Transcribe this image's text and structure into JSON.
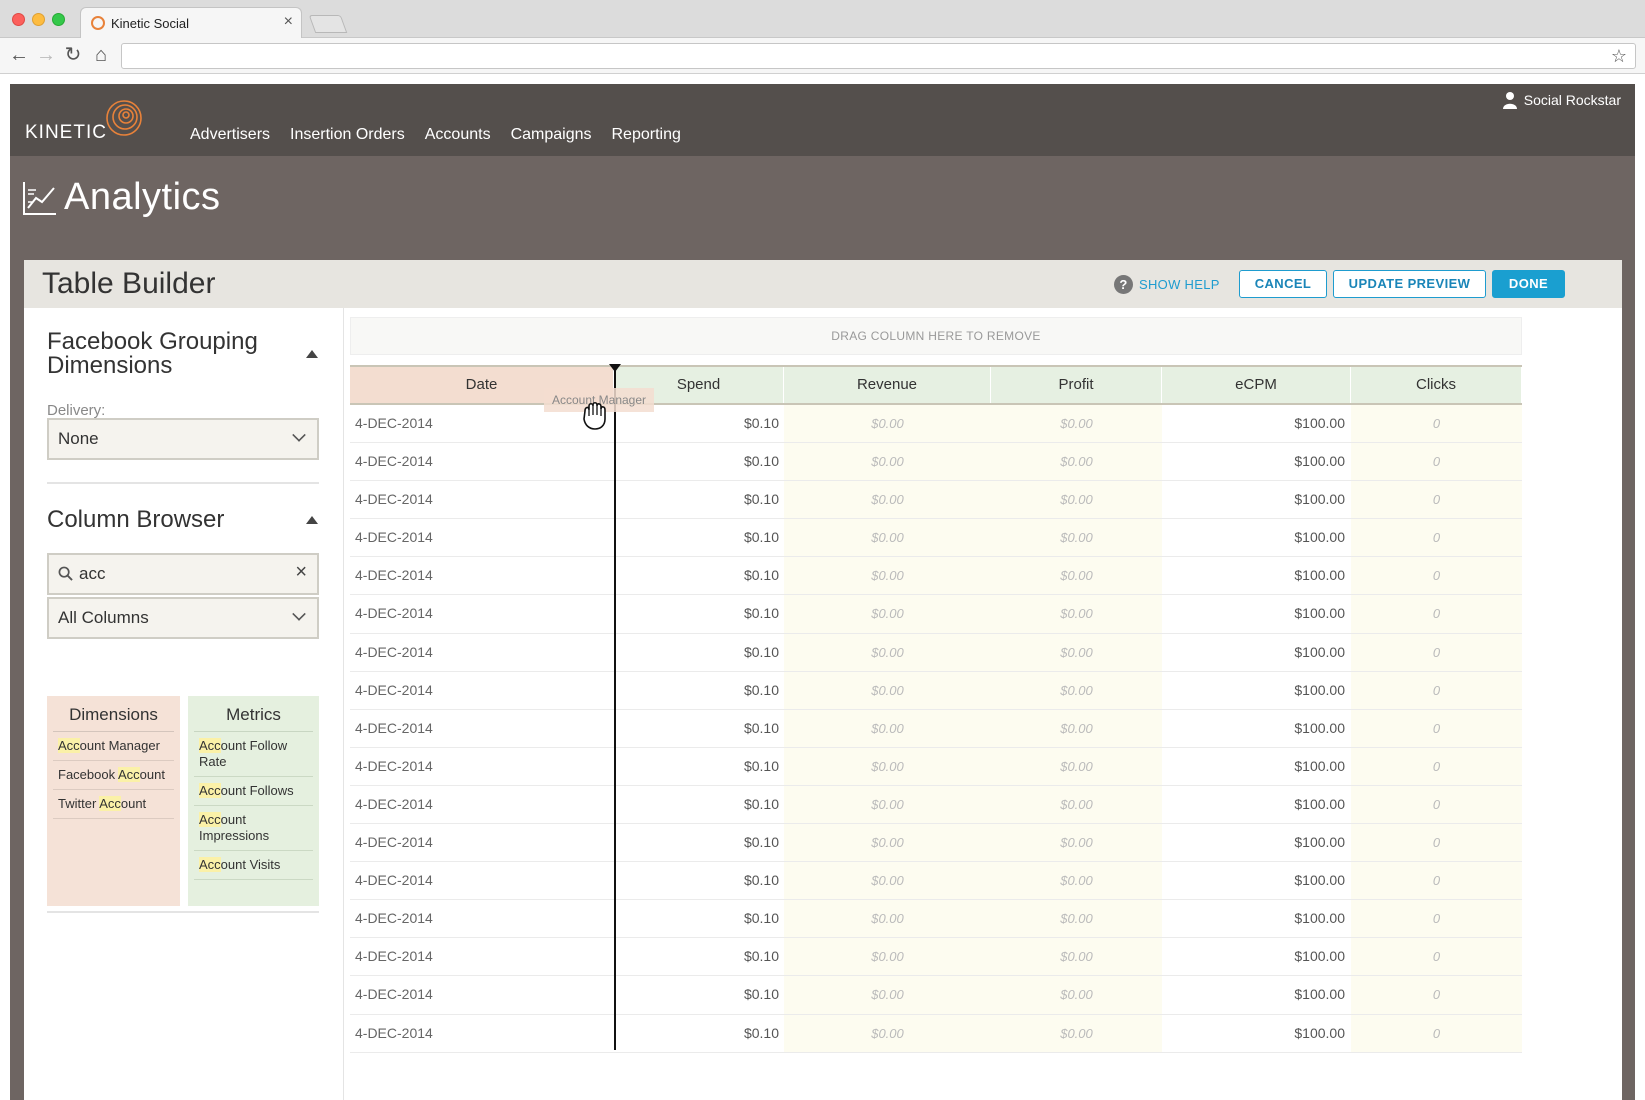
{
  "browser": {
    "tab_title": "Kinetic Social",
    "url": ""
  },
  "app": {
    "logo": "KINETIC",
    "nav": [
      "Advertisers",
      "Insertion Orders",
      "Accounts",
      "Campaigns",
      "Reporting"
    ],
    "user": "Social Rockstar",
    "page_title": "Analytics"
  },
  "panel": {
    "title": "Table Builder",
    "help_label": "SHOW HELP",
    "cancel_label": "CANCEL",
    "update_label": "UPDATE PREVIEW",
    "done_label": "DONE"
  },
  "grouping": {
    "title_line1": "Facebook Grouping",
    "title_line2": "Dimensions",
    "delivery_label": "Delivery:",
    "delivery_value": "None"
  },
  "browser_panel": {
    "title": "Column Browser",
    "search_value": "acc",
    "filter_value": "All Columns",
    "dimensions_title": "Dimensions",
    "metrics_title": "Metrics",
    "dimensions": [
      {
        "hl": "Acc",
        "rest": "ount Manager",
        "pre": ""
      },
      {
        "pre": "Facebook ",
        "hl": "Acc",
        "rest": "ount"
      },
      {
        "pre": "Twitter ",
        "hl": "Acc",
        "rest": "ount"
      }
    ],
    "metrics": [
      {
        "pre": "",
        "hl": "Acc",
        "rest": "ount Follow Rate"
      },
      {
        "pre": "",
        "hl": "Acc",
        "rest": "ount Follows"
      },
      {
        "pre": "",
        "hl": "Acc",
        "rest": "ount Impressions"
      },
      {
        "pre": "",
        "hl": "Acc",
        "rest": "ount Visits"
      }
    ]
  },
  "table": {
    "drop_zone": "DRAG COLUMN HERE TO REMOVE",
    "drag_ghost": "Account Manager",
    "columns": [
      "Date",
      "Spend",
      "Revenue",
      "Profit",
      "eCPM",
      "Clicks"
    ],
    "rows": [
      [
        "4-DEC-2014",
        "$0.10",
        "$0.00",
        "$0.00",
        "$100.00",
        "0"
      ],
      [
        "4-DEC-2014",
        "$0.10",
        "$0.00",
        "$0.00",
        "$100.00",
        "0"
      ],
      [
        "4-DEC-2014",
        "$0.10",
        "$0.00",
        "$0.00",
        "$100.00",
        "0"
      ],
      [
        "4-DEC-2014",
        "$0.10",
        "$0.00",
        "$0.00",
        "$100.00",
        "0"
      ],
      [
        "4-DEC-2014",
        "$0.10",
        "$0.00",
        "$0.00",
        "$100.00",
        "0"
      ],
      [
        "4-DEC-2014",
        "$0.10",
        "$0.00",
        "$0.00",
        "$100.00",
        "0"
      ],
      [
        "4-DEC-2014",
        "$0.10",
        "$0.00",
        "$0.00",
        "$100.00",
        "0"
      ],
      [
        "4-DEC-2014",
        "$0.10",
        "$0.00",
        "$0.00",
        "$100.00",
        "0"
      ],
      [
        "4-DEC-2014",
        "$0.10",
        "$0.00",
        "$0.00",
        "$100.00",
        "0"
      ],
      [
        "4-DEC-2014",
        "$0.10",
        "$0.00",
        "$0.00",
        "$100.00",
        "0"
      ],
      [
        "4-DEC-2014",
        "$0.10",
        "$0.00",
        "$0.00",
        "$100.00",
        "0"
      ],
      [
        "4-DEC-2014",
        "$0.10",
        "$0.00",
        "$0.00",
        "$100.00",
        "0"
      ],
      [
        "4-DEC-2014",
        "$0.10",
        "$0.00",
        "$0.00",
        "$100.00",
        "0"
      ],
      [
        "4-DEC-2014",
        "$0.10",
        "$0.00",
        "$0.00",
        "$100.00",
        "0"
      ],
      [
        "4-DEC-2014",
        "$0.10",
        "$0.00",
        "$0.00",
        "$100.00",
        "0"
      ],
      [
        "4-DEC-2014",
        "$0.10",
        "$0.00",
        "$0.00",
        "$100.00",
        "0"
      ],
      [
        "4-DEC-2014",
        "$0.10",
        "$0.00",
        "$0.00",
        "$100.00",
        "0"
      ]
    ]
  },
  "colors": {
    "accent": "#1e9ccf",
    "topnav": "#544f4c",
    "logo_orange": "#e8823a",
    "dimension_bg": "#f5e2d7",
    "metric_bg": "#e5f0df"
  },
  "icons": {
    "back": "arrow-left-icon",
    "forward": "arrow-right-icon",
    "reload": "reload-icon",
    "home": "home-icon",
    "bookmark": "star-icon",
    "user": "user-icon",
    "analytics": "chart-icon",
    "help": "question-icon",
    "search": "search-icon",
    "clear": "close-icon",
    "caret": "chevron-down-icon",
    "collapse": "triangle-up-icon",
    "drag_cursor": "grab-hand-icon"
  }
}
